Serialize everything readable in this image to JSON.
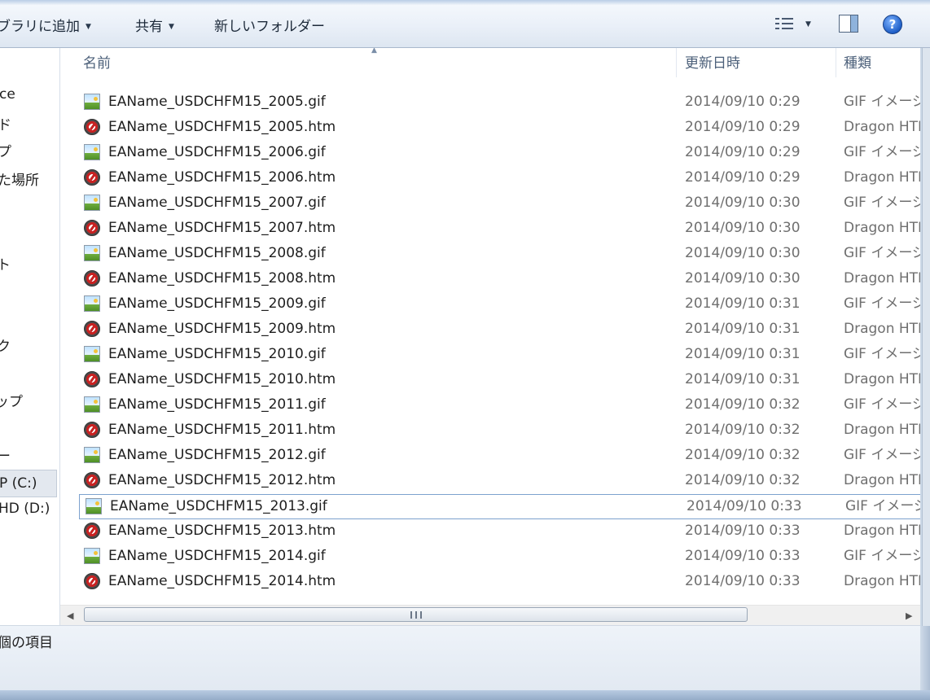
{
  "toolbar": {
    "library_label": "ブラリに追加",
    "share_label": "共有",
    "new_folder_label": "新しいフォルダー",
    "help_label": "?"
  },
  "nav": {
    "items": [
      "ce",
      "ド",
      "プ",
      "た場所",
      "ト",
      "ク",
      "ップ",
      "ー",
      "P (C:)",
      "HD (D:)",
      ","
    ]
  },
  "columns": {
    "name": "名前",
    "date": "更新日時",
    "type": "種類"
  },
  "files": [
    {
      "name": "EAName_USDCHFM15_2005.gif",
      "date": "2014/09/10 0:29",
      "type": "GIF イメージ",
      "icon": "gif-image-icon"
    },
    {
      "name": "EAName_USDCHFM15_2005.htm",
      "date": "2014/09/10 0:29",
      "type": "Dragon HTML",
      "icon": "dragon-html-icon"
    },
    {
      "name": "EAName_USDCHFM15_2006.gif",
      "date": "2014/09/10 0:29",
      "type": "GIF イメージ",
      "icon": "gif-image-icon"
    },
    {
      "name": "EAName_USDCHFM15_2006.htm",
      "date": "2014/09/10 0:29",
      "type": "Dragon HTML",
      "icon": "dragon-html-icon"
    },
    {
      "name": "EAName_USDCHFM15_2007.gif",
      "date": "2014/09/10 0:30",
      "type": "GIF イメージ",
      "icon": "gif-image-icon"
    },
    {
      "name": "EAName_USDCHFM15_2007.htm",
      "date": "2014/09/10 0:30",
      "type": "Dragon HTML",
      "icon": "dragon-html-icon"
    },
    {
      "name": "EAName_USDCHFM15_2008.gif",
      "date": "2014/09/10 0:30",
      "type": "GIF イメージ",
      "icon": "gif-image-icon"
    },
    {
      "name": "EAName_USDCHFM15_2008.htm",
      "date": "2014/09/10 0:30",
      "type": "Dragon HTML",
      "icon": "dragon-html-icon"
    },
    {
      "name": "EAName_USDCHFM15_2009.gif",
      "date": "2014/09/10 0:31",
      "type": "GIF イメージ",
      "icon": "gif-image-icon"
    },
    {
      "name": "EAName_USDCHFM15_2009.htm",
      "date": "2014/09/10 0:31",
      "type": "Dragon HTML",
      "icon": "dragon-html-icon"
    },
    {
      "name": "EAName_USDCHFM15_2010.gif",
      "date": "2014/09/10 0:31",
      "type": "GIF イメージ",
      "icon": "gif-image-icon"
    },
    {
      "name": "EAName_USDCHFM15_2010.htm",
      "date": "2014/09/10 0:31",
      "type": "Dragon HTML",
      "icon": "dragon-html-icon"
    },
    {
      "name": "EAName_USDCHFM15_2011.gif",
      "date": "2014/09/10 0:32",
      "type": "GIF イメージ",
      "icon": "gif-image-icon"
    },
    {
      "name": "EAName_USDCHFM15_2011.htm",
      "date": "2014/09/10 0:32",
      "type": "Dragon HTML",
      "icon": "dragon-html-icon"
    },
    {
      "name": "EAName_USDCHFM15_2012.gif",
      "date": "2014/09/10 0:32",
      "type": "GIF イメージ",
      "icon": "gif-image-icon"
    },
    {
      "name": "EAName_USDCHFM15_2012.htm",
      "date": "2014/09/10 0:32",
      "type": "Dragon HTML",
      "icon": "dragon-html-icon"
    },
    {
      "name": "EAName_USDCHFM15_2013.gif",
      "date": "2014/09/10 0:33",
      "type": "GIF イメージ",
      "icon": "gif-image-icon",
      "selected": true
    },
    {
      "name": "EAName_USDCHFM15_2013.htm",
      "date": "2014/09/10 0:33",
      "type": "Dragon HTML",
      "icon": "dragon-html-icon"
    },
    {
      "name": "EAName_USDCHFM15_2014.gif",
      "date": "2014/09/10 0:33",
      "type": "GIF イメージ",
      "icon": "gif-image-icon"
    },
    {
      "name": "EAName_USDCHFM15_2014.htm",
      "date": "2014/09/10 0:33",
      "type": "Dragon HTML",
      "icon": "dragon-html-icon"
    }
  ],
  "status": {
    "item_count_text": "個の項目"
  }
}
